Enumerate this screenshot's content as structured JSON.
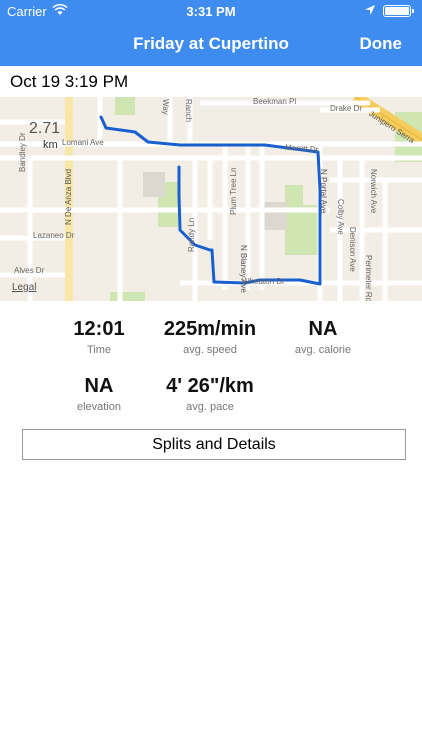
{
  "status": {
    "carrier": "Carrier",
    "time": "3:31 PM"
  },
  "nav": {
    "title": "Friday at Cupertino",
    "done_label": "Done"
  },
  "date_time": "Oct 19 3:19 PM",
  "map": {
    "distance_value": "2.71",
    "distance_unit": "km",
    "legal_label": "Legal",
    "streets": {
      "beekman": "Beekman Pl",
      "drake": "Drake Dr",
      "junipero": "Junipero Serra",
      "lomani": "Lomani Ave",
      "merritt": "Merritt Dr",
      "bandley": "Bandley Dr",
      "de_anza": "N De Anza Blvd",
      "plum_tree": "Plum Tree Ln",
      "blaney": "N Blaney Ave",
      "portal": "N Portal Ave",
      "colby": "Colby Ave",
      "norwich": "Norwich Ave",
      "denison": "Denison Ave",
      "lazaneo": "Lazaneo Dr",
      "alves": "Alves Dr",
      "randy": "Randy Ln",
      "wheaton": "Wheaton Dr",
      "perimeter": "Perimeter Rd",
      "way": "Way",
      "ranch": "Ranch"
    }
  },
  "stats": {
    "time": {
      "value": "12:01",
      "label": "Time"
    },
    "speed": {
      "value": "225m/min",
      "label": "avg. speed"
    },
    "calorie": {
      "value": "NA",
      "label": "avg. calorie"
    },
    "elevation": {
      "value": "NA",
      "label": "elevation"
    },
    "pace": {
      "value": "4' 26\"/km",
      "label": "avg. pace"
    }
  },
  "splits_button_label": "Splits and Details",
  "colors": {
    "accent": "#3f8cf0",
    "route": "#1a5fd0",
    "map_bg": "#f2eee5",
    "park": "#cfe6b3"
  }
}
